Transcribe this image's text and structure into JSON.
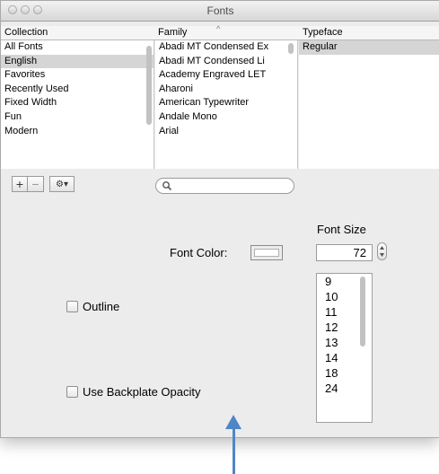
{
  "window": {
    "title": "Fonts"
  },
  "columns": {
    "collection_header": "Collection",
    "family_header": "Family",
    "typeface_header": "Typeface"
  },
  "collections": [
    "All Fonts",
    "English",
    "Favorites",
    "Recently Used",
    "Fixed Width",
    "Fun",
    "Modern"
  ],
  "selected_collection": "English",
  "families": [
    "Abadi MT Condensed Ex",
    "Abadi MT Condensed Li",
    "Academy Engraved LET",
    "Aharoni",
    "American Typewriter",
    "Andale Mono",
    "Arial"
  ],
  "typefaces": [
    "Regular"
  ],
  "toolbar": {
    "add_label": "+",
    "remove_label": "−",
    "action_label": "⚙▾"
  },
  "search": {
    "placeholder": ""
  },
  "font_color_label": "Font Color:",
  "font_size_label": "Font Size",
  "font_size_value": "72",
  "font_sizes": [
    "9",
    "10",
    "11",
    "12",
    "13",
    "14",
    "18",
    "24"
  ],
  "outline_label": "Outline",
  "backplate_label": "Use Backplate Opacity",
  "colors": {
    "selection": "#d5d5d5",
    "annotation_arrow": "#4f86c6"
  }
}
